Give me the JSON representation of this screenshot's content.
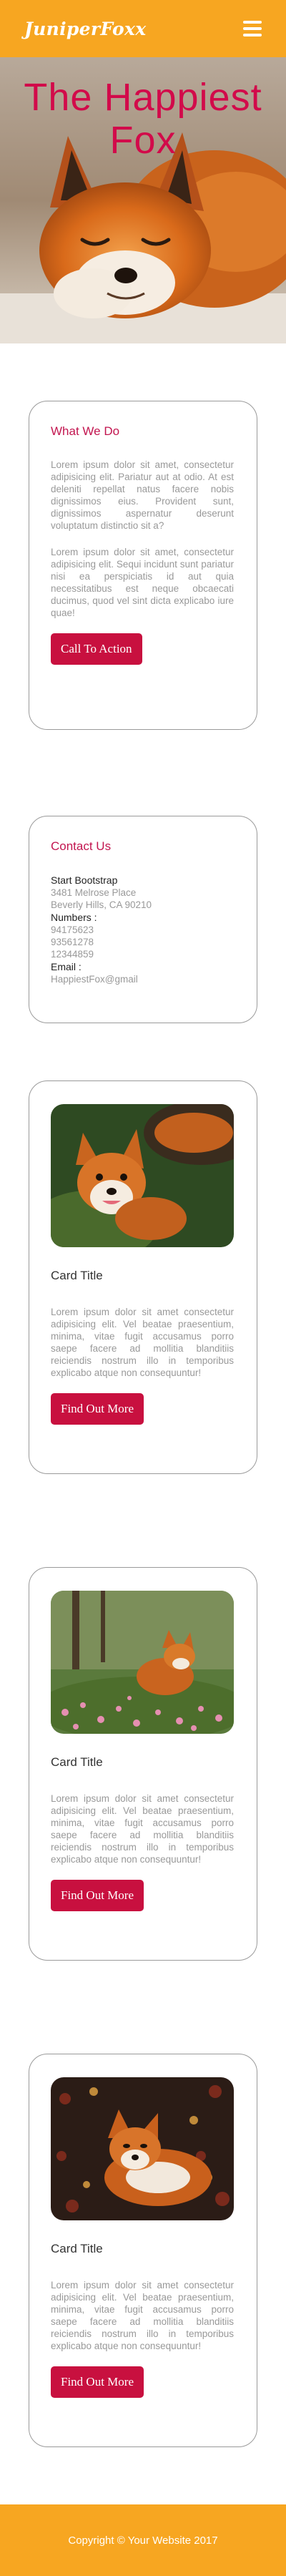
{
  "navbar": {
    "brand": "JuniperFoxx",
    "menu_icon": "hamburger-menu-icon"
  },
  "hero": {
    "title": "The  Happiest Fox"
  },
  "what_we_do": {
    "heading": "What We Do",
    "paragraph1": "Lorem ipsum dolor sit amet, consectetur adipisicing elit. Pariatur aut at odio. At est deleniti repellat natus facere nobis dignissimos eius. Provident sunt, dignissimos aspernatur deserunt voluptatum distinctio sit a?",
    "paragraph2": "Lorem ipsum dolor sit amet, consectetur adipisicing elit. Sequi incidunt sunt pariatur nisi ea perspiciatis id aut quia necessitatibus est neque obcaecati ducimus, quod vel sint dicta explicabo iure quae!",
    "button": "Call To Action"
  },
  "contact": {
    "heading": "Contact Us",
    "company": "Start Bootstrap",
    "address1": "3481 Melrose Place",
    "address2": "Beverly Hills, CA 90210",
    "numbers_label": "Numbers :",
    "number1": "94175623",
    "number2": "93561278",
    "number3": "12344859",
    "email_label": "Email :",
    "email": "HappiestFox@gmail"
  },
  "cards": [
    {
      "title": "Card Title",
      "text": "Lorem ipsum dolor sit amet consectetur adipisicing elit. Vel beatae praesentium, minima, vitae fugit accusamus porro saepe facere ad mollitia blanditiis reiciendis nostrum illo in temporibus explicabo atque non consequuntur!",
      "button": "Find Out More"
    },
    {
      "title": "Card Title",
      "text": "Lorem ipsum dolor sit amet consectetur adipisicing elit. Vel beatae praesentium, minima, vitae fugit accusamus porro saepe facere ad mollitia blanditiis reiciendis nostrum illo in temporibus explicabo atque non consequuntur!",
      "button": "Find Out More"
    },
    {
      "title": "Card Title",
      "text": "Lorem ipsum dolor sit amet consectetur adipisicing elit. Vel beatae praesentium, minima, vitae fugit accusamus porro saepe facere ad mollitia blanditiis reiciendis nostrum illo in temporibus explicabo atque non consequuntur!",
      "button": "Find Out More"
    }
  ],
  "footer": {
    "text": "Copyright © Your Website 2017"
  },
  "colors": {
    "brand_orange": "#f7a621",
    "accent_crimson": "#c8103f",
    "heading_pink": "#c2154f"
  }
}
